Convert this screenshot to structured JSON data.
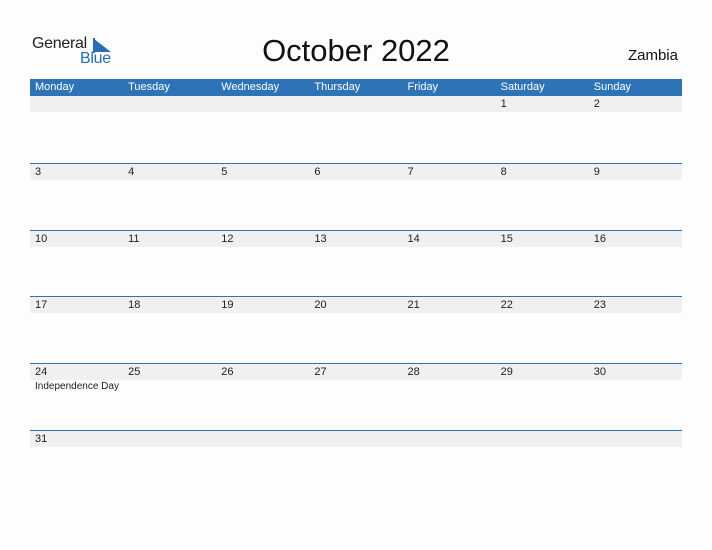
{
  "logo": {
    "line1": "General",
    "line2": "Blue"
  },
  "title": "October 2022",
  "country": "Zambia",
  "colors": {
    "accent": "#2e73b6",
    "strip": "#f0f0f0"
  },
  "weekdays": [
    "Monday",
    "Tuesday",
    "Wednesday",
    "Thursday",
    "Friday",
    "Saturday",
    "Sunday"
  ],
  "weeks": [
    {
      "days": [
        "",
        "",
        "",
        "",
        "",
        "1",
        "2"
      ],
      "events": [
        "",
        "",
        "",
        "",
        "",
        "",
        ""
      ]
    },
    {
      "days": [
        "3",
        "4",
        "5",
        "6",
        "7",
        "8",
        "9"
      ],
      "events": [
        "",
        "",
        "",
        "",
        "",
        "",
        ""
      ]
    },
    {
      "days": [
        "10",
        "11",
        "12",
        "13",
        "14",
        "15",
        "16"
      ],
      "events": [
        "",
        "",
        "",
        "",
        "",
        "",
        ""
      ]
    },
    {
      "days": [
        "17",
        "18",
        "19",
        "20",
        "21",
        "22",
        "23"
      ],
      "events": [
        "",
        "",
        "",
        "",
        "",
        "",
        ""
      ]
    },
    {
      "days": [
        "24",
        "25",
        "26",
        "27",
        "28",
        "29",
        "30"
      ],
      "events": [
        "Independence Day",
        "",
        "",
        "",
        "",
        "",
        ""
      ]
    },
    {
      "days": [
        "31",
        "",
        "",
        "",
        "",
        "",
        ""
      ],
      "events": [
        "",
        "",
        "",
        "",
        "",
        "",
        ""
      ]
    }
  ]
}
